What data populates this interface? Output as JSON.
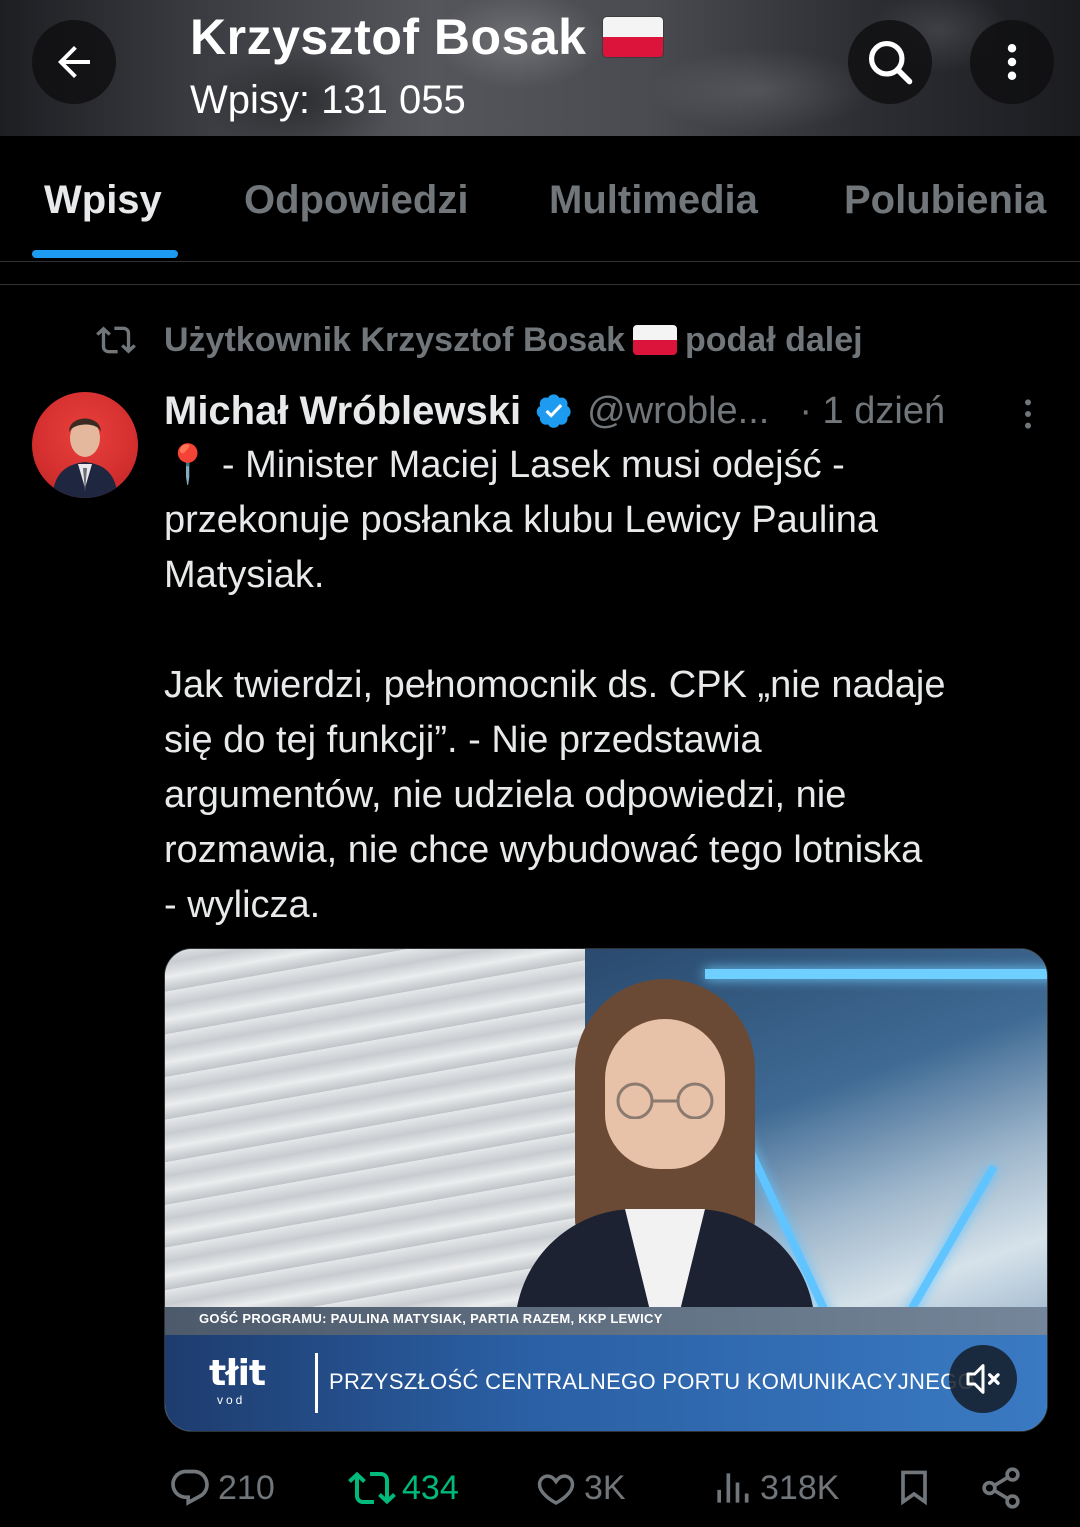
{
  "header": {
    "title": "Krzysztof Bosak",
    "posts_count": "Wpisy: 131 055"
  },
  "tabs": [
    {
      "label": "Wpisy",
      "active": true
    },
    {
      "label": "Odpowiedzi",
      "active": false
    },
    {
      "label": "Multimedia",
      "active": false
    },
    {
      "label": "Polubienia",
      "active": false
    }
  ],
  "retweet": {
    "prefix": "Użytkownik Krzysztof Bosak",
    "suffix": "podał dalej"
  },
  "tweet": {
    "author_name": "Michał Wróblewski",
    "handle": "@wroble...",
    "time": "· 1 dzień",
    "text": "📍 - Minister Maciej Lasek musi odejść -\nprzekonuje posłanka klubu Lewicy Paulina\nMatysiak.\n\nJak twierdzi, pełnomocnik ds. CPK „nie nadaje\nsię do tej funkcji”. - Nie przedstawia\nargumentów, nie udziela odpowiedzi, nie\nrozmawia, nie chce wybudować tego lotniska\n- wylicza.",
    "media": {
      "guest_caption": "GOŚĆ PROGRAMU: PAULINA MATYSIAK, PARTIA RAZEM, KKP LEWICY",
      "logo": "tłit",
      "logo_sub": "vod",
      "headline": "PRZYSZŁOŚĆ CENTRALNEGO PORTU KOMUNIKACYJNEGO"
    },
    "stats": {
      "replies": "210",
      "retweets": "434",
      "likes": "3K",
      "views": "318K"
    }
  },
  "colors": {
    "accent": "#1d9bf0",
    "retweet_green": "#00ba7c",
    "muted_text": "#71767b",
    "background": "#000000"
  },
  "icons": [
    "back-arrow-icon",
    "search-icon",
    "more-vertical-icon",
    "retweet-icon",
    "verified-badge-icon",
    "mute-icon",
    "reply-icon",
    "like-icon",
    "views-icon",
    "bookmark-icon",
    "share-icon"
  ]
}
